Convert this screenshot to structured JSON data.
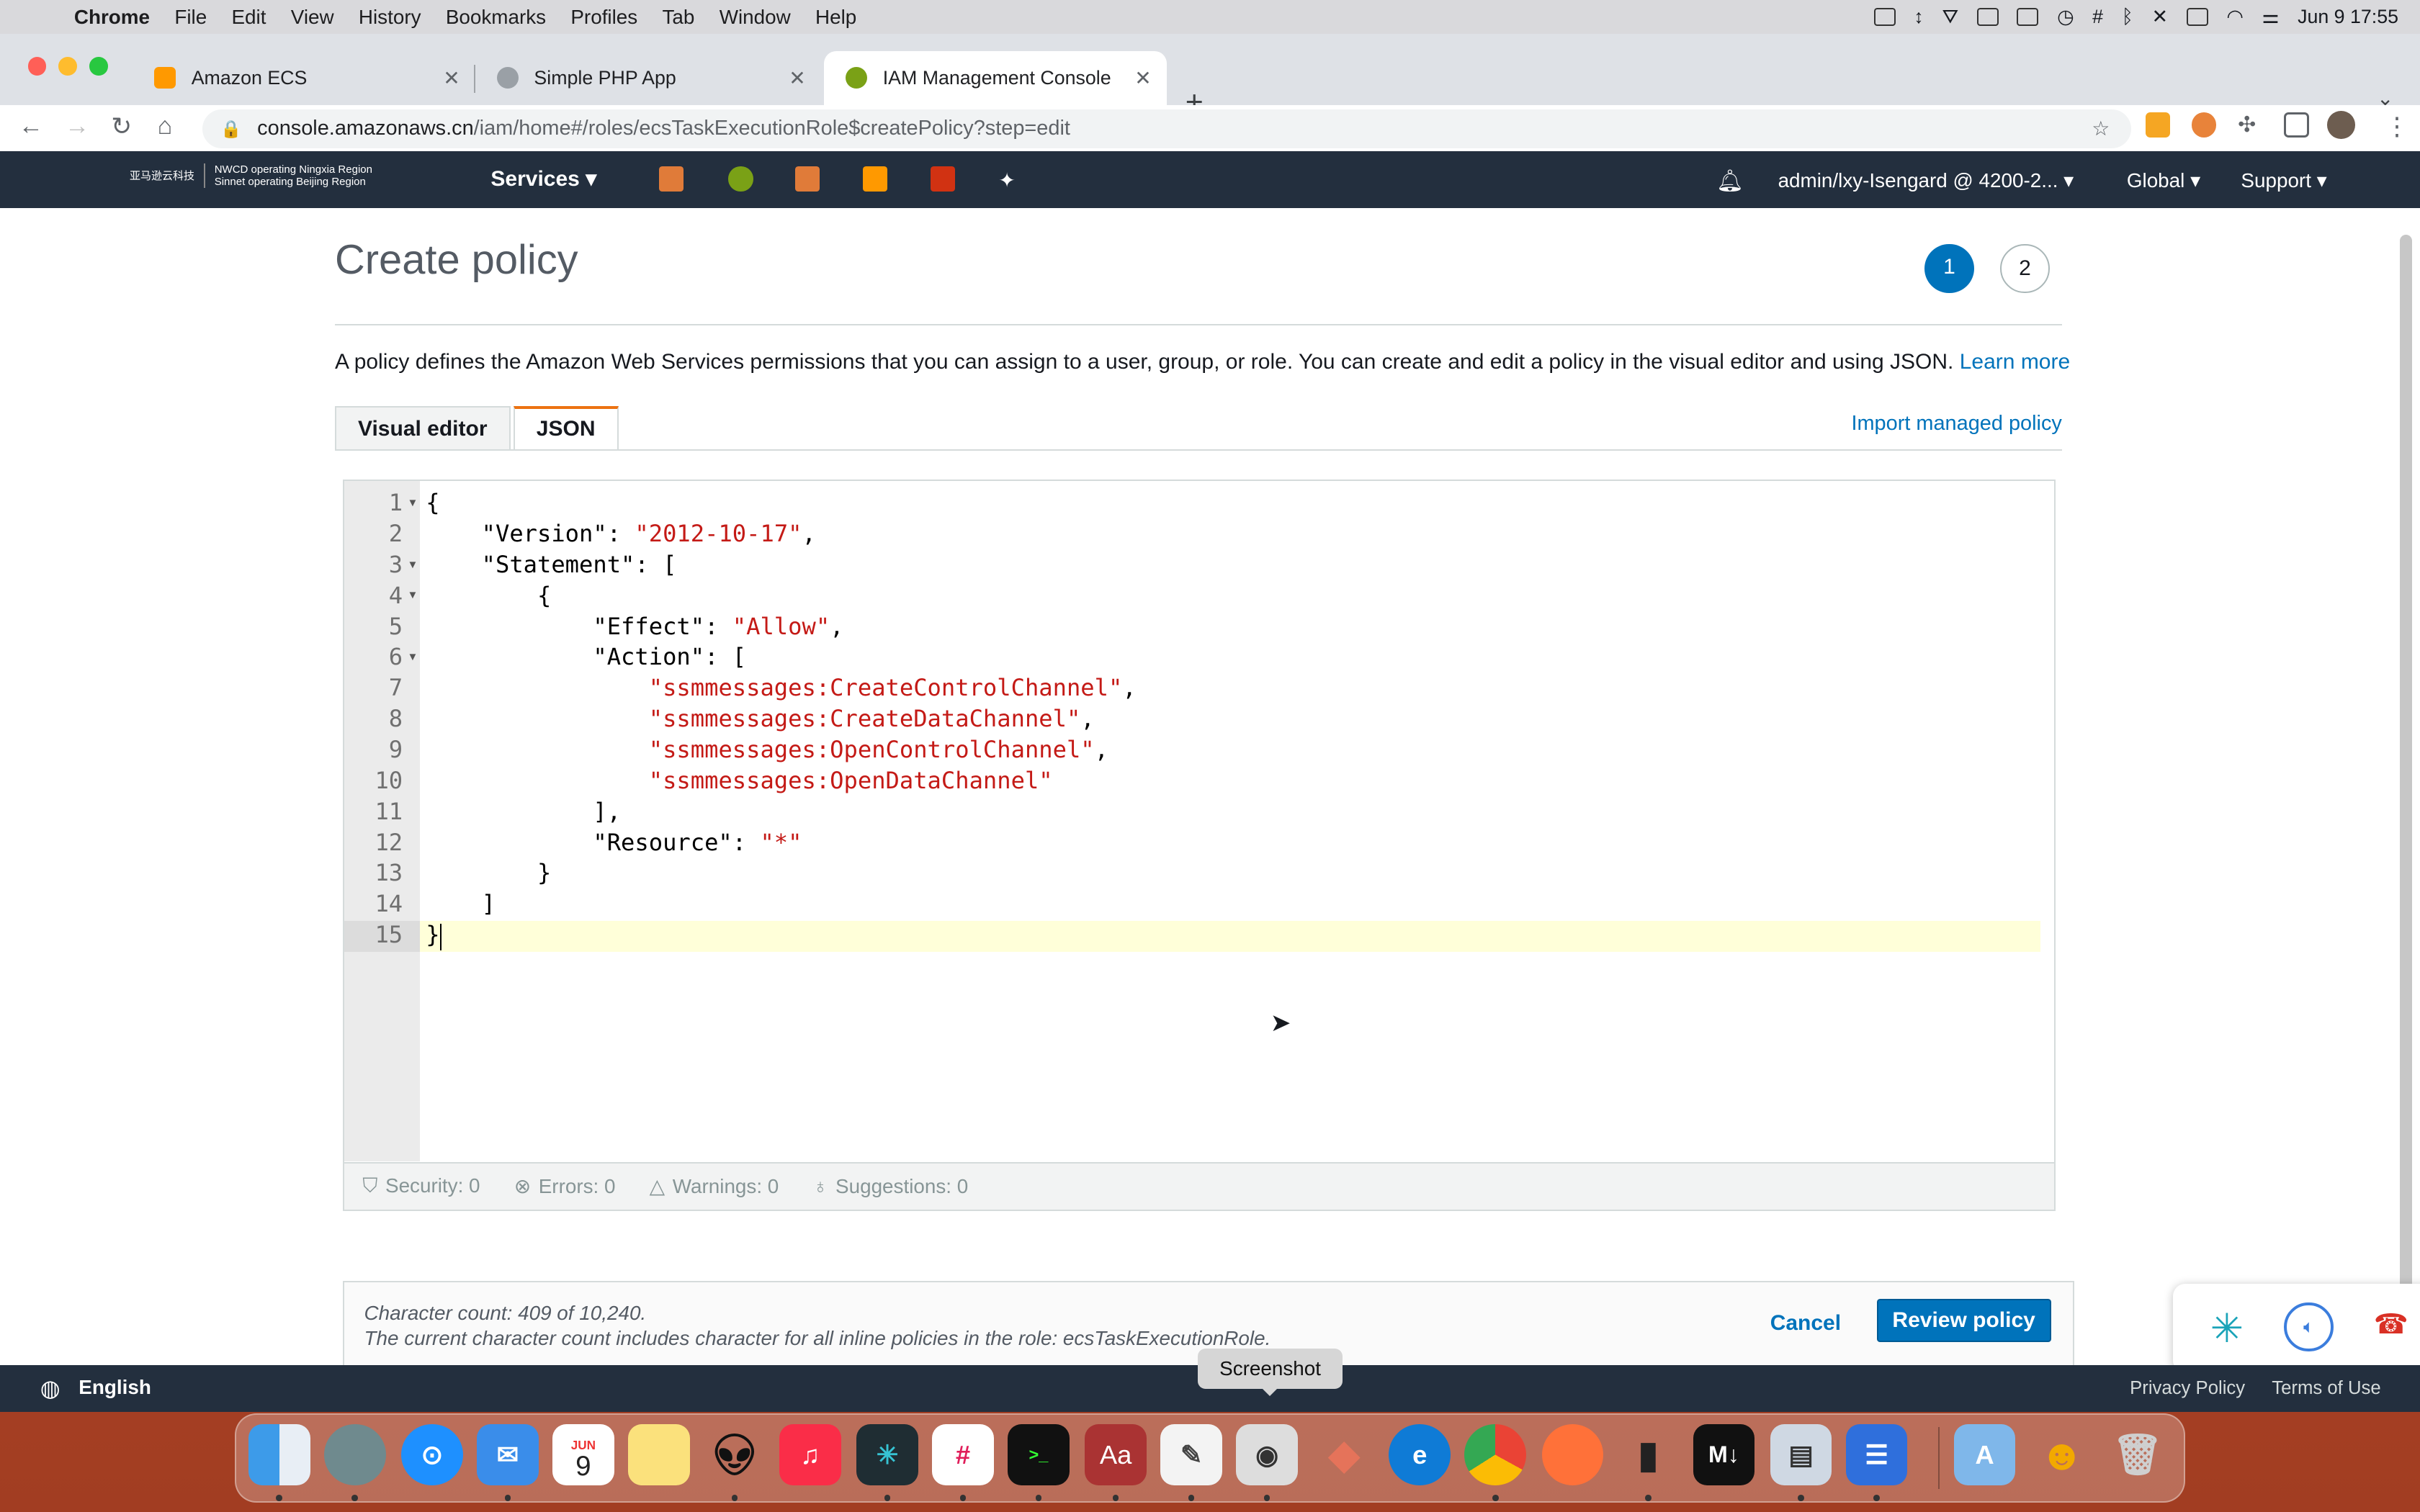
{
  "menubar": {
    "app": "Chrome",
    "items": [
      "File",
      "Edit",
      "View",
      "History",
      "Bookmarks",
      "Profiles",
      "Tab",
      "Window",
      "Help"
    ],
    "clock": "Jun 9  17:55"
  },
  "browser": {
    "tabs": [
      {
        "title": "Amazon ECS",
        "color": "#f90"
      },
      {
        "title": "Simple PHP App",
        "color": "#5f6368"
      },
      {
        "title": "IAM Management Console",
        "color": "#7aa116"
      }
    ],
    "url_host": "console.amazonaws.cn",
    "url_path": "/iam/home#/roles/ecsTaskExecutionRole$createPolicy?step=edit"
  },
  "aws_nav": {
    "logo_cn": "亚马逊云科技",
    "logo_line1": "NWCD operating Ningxia Region",
    "logo_line2": "Sinnet operating Beijing Region",
    "services": "Services ▾",
    "account": "admin/lxy-Isengard @ 4200-2... ▾",
    "region": "Global ▾",
    "support": "Support ▾"
  },
  "page": {
    "title": "Create policy",
    "step1": "1",
    "step2": "2",
    "description": "A policy defines the Amazon Web Services permissions that you can assign to a user, group, or role. You can create and edit a policy in the visual editor and using JSON.",
    "learn_more": "Learn more",
    "tab_visual": "Visual editor",
    "tab_json": "JSON",
    "import_managed": "Import managed policy"
  },
  "editor": {
    "lines": [
      "{",
      "    \"Version\": \"2012-10-17\",",
      "    \"Statement\": [",
      "        {",
      "            \"Effect\": \"Allow\",",
      "            \"Action\": [",
      "                \"ssmmessages:CreateControlChannel\",",
      "                \"ssmmessages:CreateDataChannel\",",
      "                \"ssmmessages:OpenControlChannel\",",
      "                \"ssmmessages:OpenDataChannel\"",
      "            ],",
      "            \"Resource\": \"*\"",
      "        }",
      "    ]",
      "}"
    ]
  },
  "status": {
    "security": "Security: 0",
    "errors": "Errors: 0",
    "warnings": "Warnings: 0",
    "suggestions": "Suggestions: 0"
  },
  "footer": {
    "char_count": "Character count: 409 of 10,240.",
    "char_note": "The current character count includes character for all inline policies in the role: ecsTaskExecutionRole.",
    "cancel": "Cancel",
    "review": "Review policy"
  },
  "langbar": {
    "language": "English",
    "privacy": "Privacy Policy",
    "terms": "Terms of Use"
  },
  "tooltip": "Screenshot",
  "dock": {
    "calendar_month": "JUN",
    "calendar_day": "9",
    "dictionary": "Aa",
    "markdown": "M↓",
    "apps": [
      "finder",
      "network",
      "safari",
      "mail",
      "calendar",
      "notes",
      "alien",
      "music",
      "perplexity",
      "slack",
      "terminal",
      "dictionary",
      "textedit",
      "screenshot",
      "blocks",
      "edge",
      "chrome",
      "firefox",
      "thermometer",
      "markdown",
      "preview",
      "files",
      "appstore-folder",
      "mascot",
      "trash"
    ]
  }
}
